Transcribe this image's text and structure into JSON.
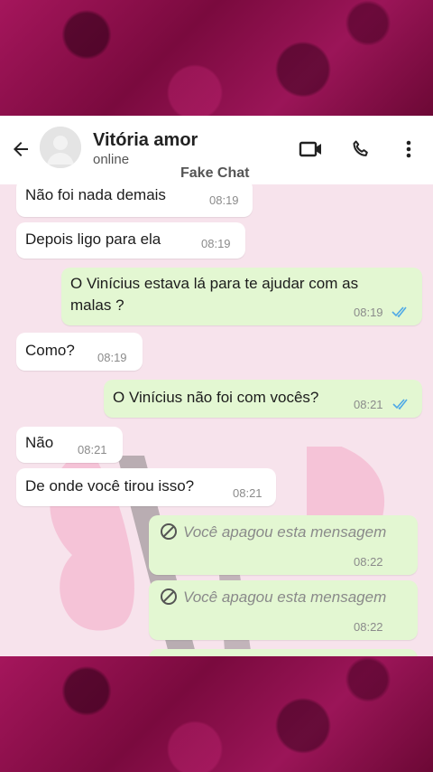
{
  "header": {
    "contact_name": "Vitória amor",
    "status": "online",
    "watermark": "Fake Chat"
  },
  "colors": {
    "outgoing_bubble": "#e3f7d2",
    "incoming_bubble": "#ffffff",
    "read_ticks": "#4fa9e6",
    "background_magenta": "#8e0f4c"
  },
  "icons": {
    "back": "arrow-left-icon",
    "video": "video-call-icon",
    "call": "phone-icon",
    "menu": "more-vertical-icon"
  },
  "messages": [
    {
      "dir": "in",
      "text": "Não foi nada demais",
      "time": "08:19"
    },
    {
      "dir": "in",
      "text": "Depois ligo para ela",
      "time": "08:19"
    },
    {
      "dir": "out",
      "line1": "O Vinícius estava lá para te ajudar com as",
      "line2": "malas ?",
      "time": "08:19"
    },
    {
      "dir": "in",
      "text": "Como?",
      "time": "08:19"
    },
    {
      "dir": "out",
      "text": "O Vinícius não foi com vocês?",
      "time": "08:21"
    },
    {
      "dir": "in",
      "text": "Não",
      "time": "08:21"
    },
    {
      "dir": "in",
      "text": "De onde você tirou isso?",
      "time": "08:21"
    },
    {
      "dir": "out",
      "deleted": true,
      "text": "Você apagou esta mensagem",
      "time": "08:22"
    },
    {
      "dir": "out",
      "deleted": true,
      "text": "Você apagou esta mensagem",
      "time": "08:22"
    }
  ]
}
